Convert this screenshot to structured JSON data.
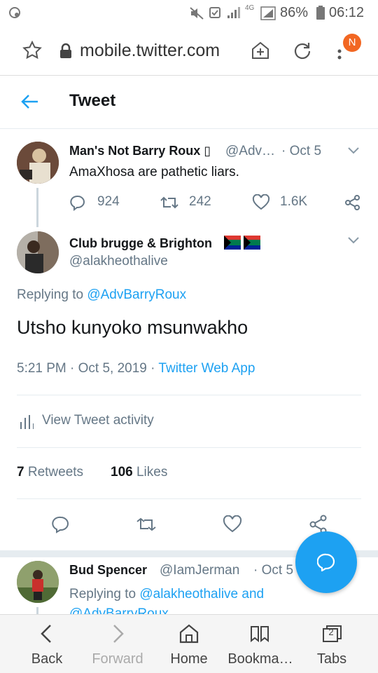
{
  "status_bar": {
    "battery_percent": "86%",
    "time": "06:12",
    "network": "4G"
  },
  "browser": {
    "url": "mobile.twitter.com",
    "menu_badge": "N"
  },
  "header": {
    "title": "Tweet"
  },
  "parent_tweet": {
    "display_name": "Man's Not Barry Roux ▯",
    "handle": "@Adv…",
    "time": "· Oct 5",
    "text": "AmaXhosa are pathetic liars.",
    "replies": "924",
    "retweets": "242",
    "likes": "1.6K"
  },
  "main_tweet": {
    "display_name": "Club brugge & Brighton",
    "handle": "@alakheothalive",
    "replying_prefix": "Replying to ",
    "replying_to": "@AdvBarryRoux",
    "text": "Utsho kunyoko msunwakho",
    "timestamp": "5:21 PM · Oct 5, 2019 · ",
    "source": "Twitter Web App",
    "activity_label": "View Tweet activity",
    "retweet_count": "7",
    "retweet_label": "Retweets",
    "like_count": "106",
    "like_label": "Likes"
  },
  "reply_tweet": {
    "display_name": "Bud Spencer",
    "handle": "@IamJerman",
    "time": "· Oct 5",
    "replying_prefix": "Replying to ",
    "replying_to_1": "@alakheothalive",
    "and_word": " and",
    "replying_to_2": "@AdvBarryRoux"
  },
  "bottom_nav": {
    "back": "Back",
    "forward": "Forward",
    "home": "Home",
    "bookmarks": "Bookma…",
    "tabs": "Tabs",
    "tab_count": "2"
  },
  "colors": {
    "accent": "#1da1f2",
    "text": "#14171a",
    "muted": "#657786",
    "badge": "#f26722"
  }
}
